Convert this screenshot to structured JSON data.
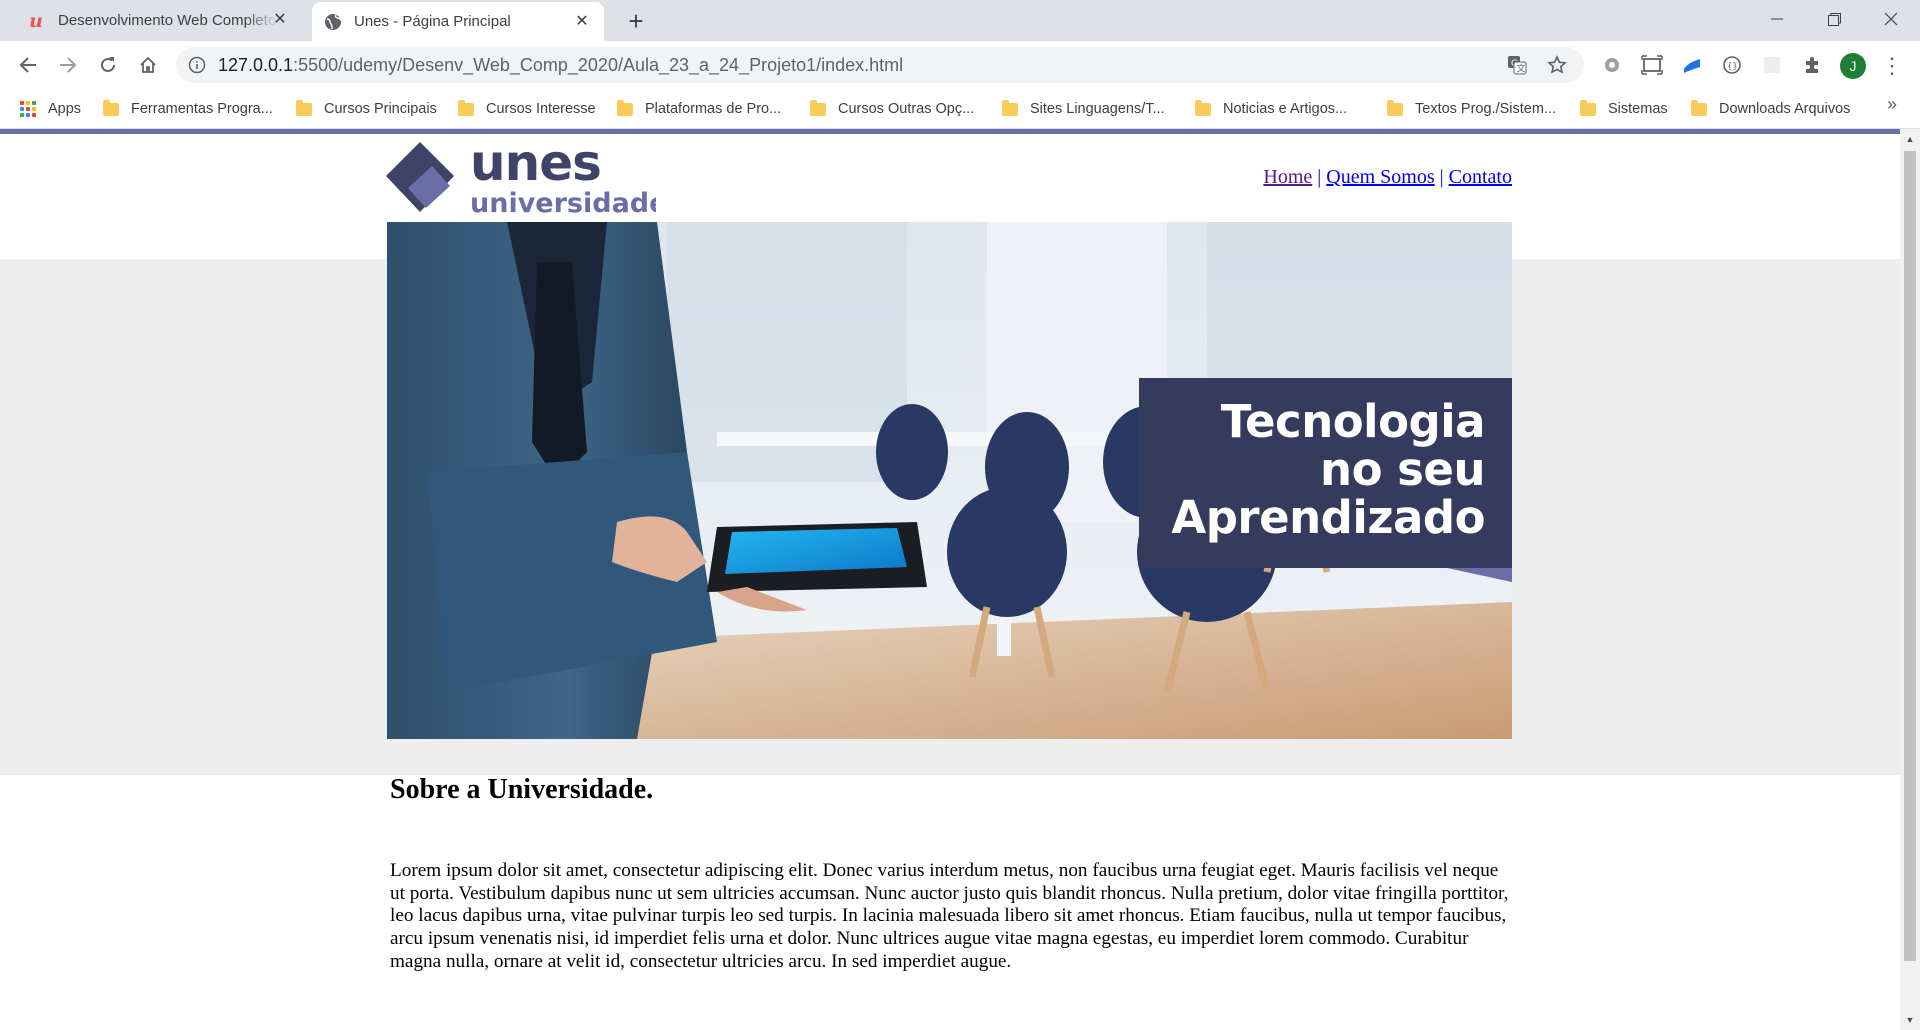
{
  "browser": {
    "tabs": [
      {
        "title": "Desenvolvimento Web Completo",
        "icon": "udemy-icon",
        "active": false
      },
      {
        "title": "Unes - Página Principal",
        "icon": "globe-icon",
        "active": true
      }
    ],
    "address": {
      "host": "127.0.0.1",
      "path": ":5500/udemy/Desenv_Web_Comp_2020/Aula_23_a_24_Projeto1/index.html"
    },
    "profile_initial": "J",
    "bookmarks": [
      "Apps",
      "Ferramentas Progra...",
      "Cursos Principais",
      "Cursos Interesse",
      "Plataformas de Pro...",
      "Cursos Outras Opç...",
      "Sites Linguagens/T...",
      "Noticias e Artigos...",
      "Textos Prog./Sistem...",
      "Sistemas",
      "Downloads Arquivos"
    ]
  },
  "site": {
    "logo": {
      "word": "unes",
      "sub": "universidade"
    },
    "nav": [
      {
        "label": "Home",
        "visited": true
      },
      {
        "label": "Quem Somos",
        "visited": false
      },
      {
        "label": "Contato",
        "visited": false
      }
    ],
    "nav_separator": "|",
    "hero": {
      "lines": [
        "Tecnologia",
        "no seu",
        "Aprendizado"
      ]
    },
    "about": {
      "title": "Sobre a Universidade.",
      "text": "Lorem ipsum dolor sit amet, consectetur adipiscing elit. Donec varius interdum metus, non faucibus urna feugiat eget. Mauris facilisis vel neque ut porta. Vestibulum dapibus nunc ut sem ultricies accumsan. Nunc auctor justo quis blandit rhoncus. Nulla pretium, dolor vitae fringilla porttitor, leo lacus dapibus urna, vitae pulvinar turpis leo sed turpis. In lacinia malesuada libero sit amet rhoncus. Etiam faucibus, nulla ut tempor faucibus, arcu ipsum venenatis nisi, id imperdiet felis urna et dolor. Nunc ultrices augue vitae magna egestas, eu imperdiet lorem commodo. Curabitur magna nulla, ornare at velit id, consectetur ultricies arcu. In sed imperdiet augue."
    }
  },
  "colors": {
    "logo_dark": "#3e4468",
    "logo_light": "#6a6ea6",
    "hero_box": "#343b5c",
    "banner_band": "#eeeeee"
  }
}
